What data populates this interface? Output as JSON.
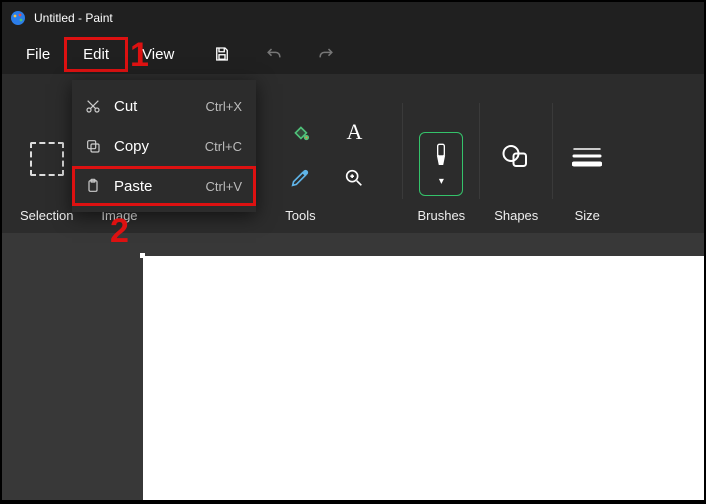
{
  "title": "Untitled - Paint",
  "menubar": {
    "file": "File",
    "edit": "Edit",
    "view": "View"
  },
  "dropdown": {
    "cut": {
      "label": "Cut",
      "shortcut": "Ctrl+X"
    },
    "copy": {
      "label": "Copy",
      "shortcut": "Ctrl+C"
    },
    "paste": {
      "label": "Paste",
      "shortcut": "Ctrl+V"
    }
  },
  "ribbon": {
    "selection": "Selection",
    "image": "Image",
    "tools": "Tools",
    "brushes": "Brushes",
    "shapes": "Shapes",
    "size": "Size"
  },
  "annotations": {
    "one": "1",
    "two": "2"
  }
}
